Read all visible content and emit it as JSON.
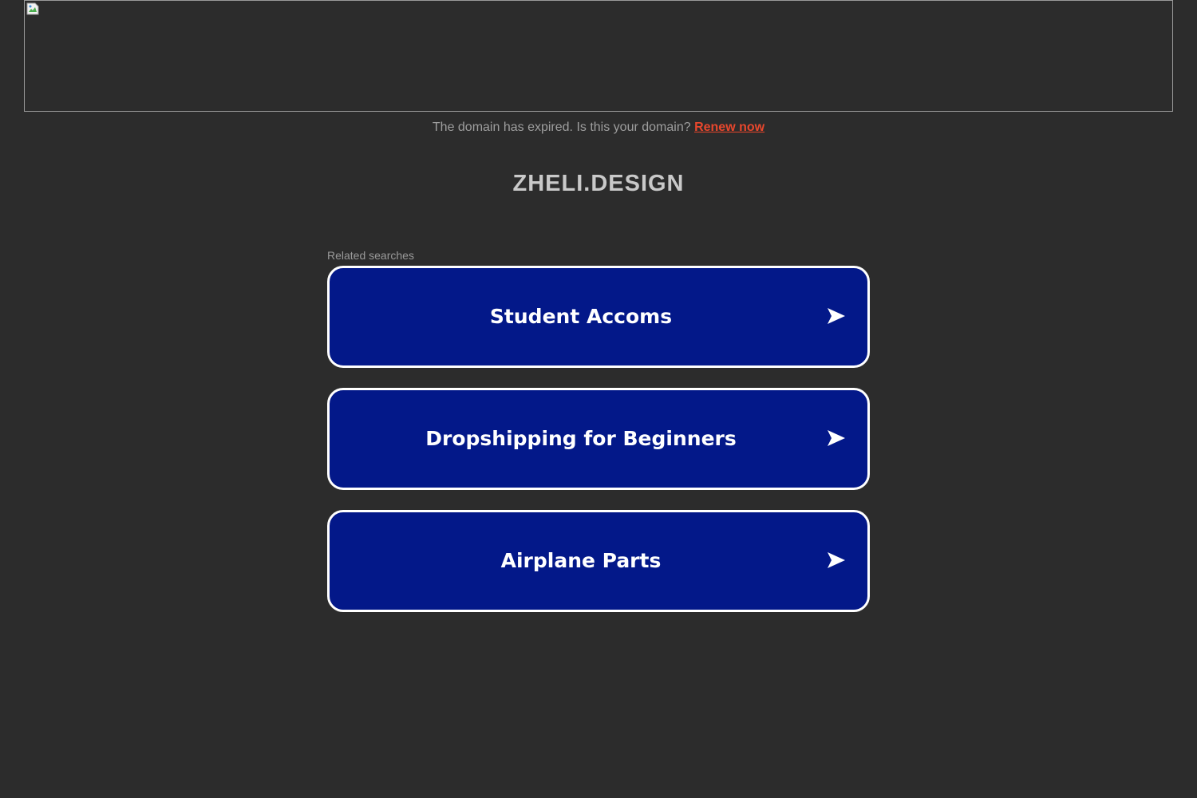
{
  "banner": {
    "icon": "broken-image-icon"
  },
  "notice": {
    "text": "The domain has expired. Is this your domain?",
    "link_label": "Renew now",
    "link_color": "#e8472d"
  },
  "domain": {
    "name": "ZHELI.DESIGN"
  },
  "related": {
    "heading": "Related searches",
    "items": [
      {
        "label": "Student Accoms",
        "icon": "arrow-right-icon"
      },
      {
        "label": "Dropshipping for Beginners",
        "icon": "arrow-right-icon"
      },
      {
        "label": "Airplane Parts",
        "icon": "arrow-right-icon"
      }
    ]
  },
  "colors": {
    "background": "#2c2c2c",
    "button_fill": "#031889",
    "button_border": "#ffffff",
    "muted_text": "#9e9e9e",
    "title_text": "#c9c9c9"
  }
}
